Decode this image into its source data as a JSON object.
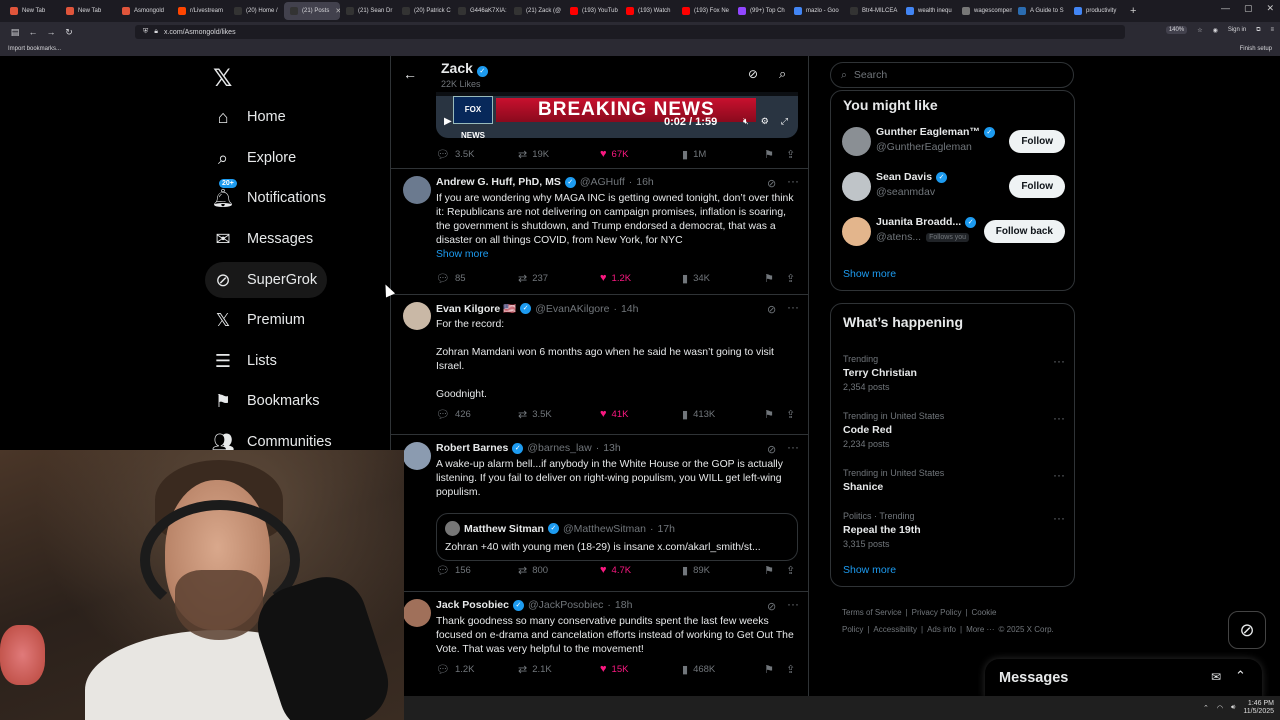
{
  "browser": {
    "tabs": [
      {
        "label": "New Tab",
        "color": "#e0553b"
      },
      {
        "label": "New Tab",
        "color": "#e0553b"
      },
      {
        "label": "Asmongold",
        "color": "#e0553b"
      },
      {
        "label": "r/Livestream",
        "color": "#ff4500"
      },
      {
        "label": "(20) Home /",
        "color": "#333333"
      },
      {
        "label": "(21) Posts",
        "color": "#333333",
        "active": true
      },
      {
        "label": "(21) Sean Dr",
        "color": "#333333"
      },
      {
        "label": "(20) Patrick C",
        "color": "#333333"
      },
      {
        "label": "G446aK7XIA:",
        "color": "#333333"
      },
      {
        "label": "(21) Zack (@",
        "color": "#333333"
      },
      {
        "label": "(193) YouTub",
        "color": "#ff0000"
      },
      {
        "label": "(193) Watch",
        "color": "#ff0000"
      },
      {
        "label": "(193) Fox Ne",
        "color": "#ff0000"
      },
      {
        "label": "(99+) Top Ch",
        "color": "#9146ff"
      },
      {
        "label": "mazlo - Goo",
        "color": "#4285f4"
      },
      {
        "label": "Btr4-MILCEA",
        "color": "#333333"
      },
      {
        "label": "wealth inequ",
        "color": "#4285f4"
      },
      {
        "label": "wagescompens",
        "color": "#777777"
      },
      {
        "label": "A Guide to S",
        "color": "#2b6cb0"
      },
      {
        "label": "productivity",
        "color": "#4285f4"
      }
    ],
    "url": "x.com/Asmongold/likes",
    "zoom": "140%",
    "import_bookmarks": "Import bookmarks...",
    "sign_in": "Sign in",
    "finish_setup": "Finish setup"
  },
  "nav": {
    "items": [
      {
        "label": "Home",
        "icon": "home-icon",
        "glyph": "⌂"
      },
      {
        "label": "Explore",
        "icon": "search-icon",
        "glyph": "⌕"
      },
      {
        "label": "Notifications",
        "icon": "bell-icon",
        "glyph": "🔔︎",
        "badge": "20+"
      },
      {
        "label": "Messages",
        "icon": "mail-icon",
        "glyph": "✉"
      },
      {
        "label": "SuperGrok",
        "icon": "grok-icon",
        "glyph": "⊘"
      },
      {
        "label": "Premium",
        "icon": "x-premium-icon",
        "glyph": "𝕏"
      },
      {
        "label": "Lists",
        "icon": "lists-icon",
        "glyph": "☰"
      },
      {
        "label": "Bookmarks",
        "icon": "bookmark-icon",
        "glyph": "⚑"
      },
      {
        "label": "Communities",
        "icon": "communities-icon",
        "glyph": "👥︎"
      }
    ]
  },
  "profile_header": {
    "name": "Zack",
    "likes_count": "22K Likes"
  },
  "video_tweet": {
    "banner": "BREAKING NEWS",
    "channel": "FOX NEWS",
    "time": "0:02 / 1:59",
    "replies": "3.5K",
    "reposts": "19K",
    "likes": "67K",
    "views": "1M"
  },
  "tweets": [
    {
      "name": "Andrew G. Huff, PhD, MS",
      "handle": "@AGHuff",
      "time": "16h",
      "body": "If you are wondering why MAGA INC is getting owned tonight, don’t over think it: Republicans are not delivering on campaign promises, inflation is soaring, the government is shutdown, and Trump endorsed a democrat, that was a disaster on all things COVID, from New York, for NYC",
      "show_more": "Show more",
      "replies": "85",
      "reposts": "237",
      "likes": "1.2K",
      "views": "34K"
    },
    {
      "name": "Evan Kilgore 🇺🇸",
      "handle": "@EvanAKilgore",
      "time": "14h",
      "body": "For the record:\n\nZohran Mamdani won 6 months ago when he said he wasn’t going to visit Israel.\n\nGoodnight.",
      "replies": "426",
      "reposts": "3.5K",
      "likes": "41K",
      "views": "413K"
    },
    {
      "name": "Robert Barnes",
      "handle": "@barnes_law",
      "time": "13h",
      "body": "A wake-up alarm bell...if anybody in the White House or the GOP is actually listening. If you fail to deliver on right-wing populism, you WILL get left-wing populism.",
      "quote": {
        "name": "Matthew Sitman",
        "handle": "@MatthewSitman",
        "time": "17h",
        "body": "Zohran +40 with young men (18-29) is insane x.com/akarl_smith/st..."
      },
      "replies": "156",
      "reposts": "800",
      "likes": "4.7K",
      "views": "89K"
    },
    {
      "name": "Jack Posobiec",
      "handle": "@JackPosobiec",
      "time": "18h",
      "body": "Thank goodness so many conservative pundits spent the last few weeks focused on e-drama and cancelation efforts instead of working to Get Out The Vote. That was very helpful to the movement!",
      "replies": "1.2K",
      "reposts": "2.1K",
      "likes": "15K",
      "views": "468K"
    }
  ],
  "sidebar": {
    "search_placeholder": "Search",
    "you_might_like": "You might like",
    "suggestions": [
      {
        "name": "Gunther Eagleman™",
        "handle": "@GuntherEagleman",
        "button": "Follow",
        "avatar_color": "#8a8f94"
      },
      {
        "name": "Sean Davis",
        "handle": "@seanmdav",
        "button": "Follow",
        "avatar_color": "#bfc4c8"
      },
      {
        "name": "Juanita Broadd...",
        "handle": "@atens...",
        "follows_you": "Follows you",
        "button": "Follow back",
        "avatar_color": "#e3b58c"
      }
    ],
    "show_more": "Show more",
    "whats_happening": "What’s happening",
    "trends": [
      {
        "meta": "Trending",
        "name": "Terry Christian",
        "count": "2,354 posts"
      },
      {
        "meta": "Trending in United States",
        "name": "Code Red",
        "count": "2,234 posts"
      },
      {
        "meta": "Trending in United States",
        "name": "Shanice",
        "count": ""
      },
      {
        "meta": "Politics · Trending",
        "name": "Repeal the 19th",
        "count": "3,315 posts"
      }
    ],
    "footer": [
      "Terms of Service",
      "|",
      "Privacy Policy",
      "|",
      "Cookie Policy",
      "|",
      "Accessibility",
      "|",
      "Ads info",
      "|",
      "More ···",
      "© 2025 X Corp."
    ]
  },
  "messages_drawer": {
    "title": "Messages"
  },
  "taskbar": {
    "time": "1:46 PM",
    "date": "11/5/2025"
  }
}
